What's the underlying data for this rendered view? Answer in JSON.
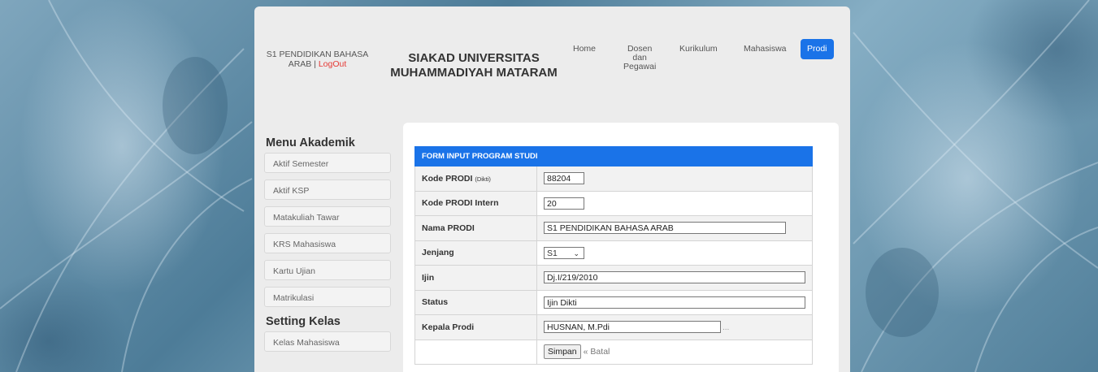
{
  "header": {
    "user_line1": "S1 PENDIDIKAN BAHASA",
    "user_line2": "ARAB | ",
    "logout": "LogOut",
    "title_line1": "SIAKAD UNIVERSITAS",
    "title_line2": "MUHAMMADIYAH MATARAM"
  },
  "nav": {
    "home": "Home",
    "dosen_line1": "Dosen",
    "dosen_line2": "dan",
    "dosen_line3": "Pegawai",
    "kurikulum": "Kurikulum",
    "mahasiswa": "Mahasiswa",
    "prodi": "Prodi"
  },
  "sidebar": {
    "menu_title": "Menu Akademik",
    "items": [
      "Aktif Semester",
      "Aktif KSP",
      "Matakuliah Tawar",
      "KRS Mahasiswa",
      "Kartu Ujian",
      "Matrikulasi"
    ],
    "setting_title": "Setting Kelas",
    "setting_items": [
      "Kelas Mahasiswa"
    ]
  },
  "form": {
    "title": "FORM INPUT PROGRAM STUDI",
    "kode_prodi_label": "Kode PRODI ",
    "kode_prodi_sub": "(Dikti)",
    "kode_prodi_value": "88204",
    "kode_intern_label": "Kode PRODI Intern",
    "kode_intern_value": "20",
    "nama_label": "Nama PRODI",
    "nama_value": "S1 PENDIDIKAN BAHASA ARAB",
    "jenjang_label": "Jenjang",
    "jenjang_value": "S1",
    "ijin_label": "Ijin",
    "ijin_value": "Dj.I/219/2010",
    "status_label": "Status",
    "status_value": "Ijin Dikti",
    "kepala_label": "Kepala Prodi",
    "kepala_value": "HUSNAN, M.Pdi",
    "kepala_more": "...",
    "simpan": "Simpan",
    "batal": "« Batal"
  },
  "colors": {
    "accent": "#1a73e8",
    "logout": "#e53935"
  }
}
